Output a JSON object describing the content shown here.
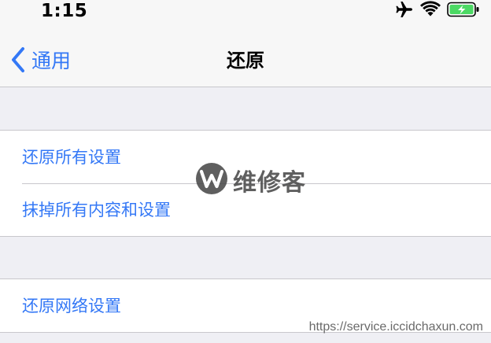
{
  "status_bar": {
    "time": "1:15",
    "icons": [
      "airplane-icon",
      "wifi-icon",
      "battery-charging-icon"
    ],
    "battery_color": "#4cd964"
  },
  "nav": {
    "back_label": "通用",
    "title": "还原"
  },
  "groups": [
    {
      "items": [
        {
          "label": "还原所有设置"
        },
        {
          "label": "抹掉所有内容和设置"
        }
      ]
    },
    {
      "items": [
        {
          "label": "还原网络设置"
        }
      ]
    }
  ],
  "watermark": {
    "text": "维修客"
  },
  "source_url": "https://service.iccidchaxun.com",
  "colors": {
    "accent": "#3478f6",
    "background": "#efeff4",
    "bar": "#f7f7f7",
    "separator": "#c8c7cc"
  }
}
